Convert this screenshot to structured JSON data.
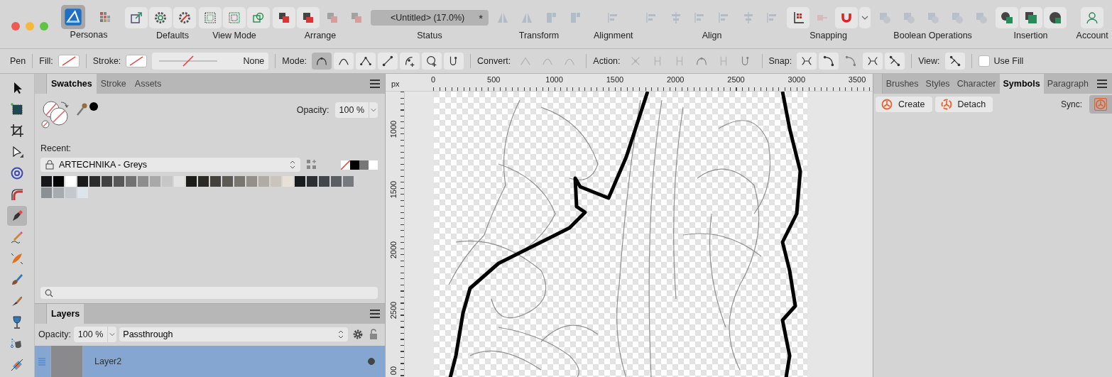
{
  "toolbar": {
    "groups": [
      {
        "kind": "buttons",
        "label": "Personas",
        "buttons": [
          {
            "selected": true,
            "disabled": false
          },
          {
            "selected": false,
            "disabled": false
          }
        ]
      },
      {
        "kind": "buttons",
        "buttons": [
          {
            "disabled": false
          }
        ]
      },
      {
        "kind": "buttons",
        "label": "Defaults",
        "buttons": [
          {
            "disabled": false
          },
          {
            "disabled": false
          }
        ]
      },
      {
        "kind": "buttons",
        "label": "View Mode",
        "buttons": [
          {
            "disabled": false
          },
          {
            "disabled": false
          },
          {
            "disabled": false
          }
        ]
      },
      {
        "kind": "buttons",
        "label": "Arrange",
        "buttons": [
          {
            "disabled": false
          },
          {
            "disabled": false
          },
          {
            "disabled": true
          },
          {
            "disabled": true
          }
        ]
      },
      {
        "kind": "status",
        "label": "Status",
        "title": "<Untitled> (17.0%)",
        "modified": "*"
      },
      {
        "kind": "buttons",
        "label": "Transform",
        "buttons": [
          {
            "disabled": true
          },
          {
            "disabled": true
          },
          {
            "disabled": true
          },
          {
            "disabled": true
          }
        ]
      },
      {
        "kind": "buttons",
        "label": "Alignment",
        "buttons": [
          {
            "disabled": true
          }
        ]
      },
      {
        "kind": "buttons",
        "label": "Align",
        "buttons": [
          {
            "disabled": true
          },
          {
            "disabled": true
          },
          {
            "disabled": true
          },
          {
            "disabled": true
          },
          {
            "disabled": true
          },
          {
            "disabled": true
          }
        ]
      },
      {
        "kind": "buttons",
        "label": "Snapping",
        "buttons": [
          {
            "disabled": false
          },
          {
            "disabled": true
          },
          {
            "disabled": false
          },
          {
            "disabled": false
          }
        ]
      },
      {
        "kind": "buttons",
        "label": "Boolean Operations",
        "buttons": [
          {
            "disabled": true
          },
          {
            "disabled": true
          },
          {
            "disabled": true
          },
          {
            "disabled": true
          },
          {
            "disabled": true
          }
        ]
      },
      {
        "kind": "buttons",
        "label": "Insertion",
        "buttons": [
          {
            "disabled": false
          },
          {
            "disabled": false
          },
          {
            "disabled": false
          }
        ]
      },
      {
        "kind": "buttons",
        "label": "Account",
        "buttons": [
          {
            "disabled": false
          }
        ]
      }
    ]
  },
  "context_toolbar": {
    "tool": "Pen",
    "fill_label": "Fill:",
    "stroke_label": "Stroke:",
    "stroke_width": "None",
    "sections": [
      {
        "label": "Mode:",
        "buttons": [
          {
            "selected": true,
            "disabled": false
          },
          {
            "selected": false,
            "disabled": false
          },
          {
            "selected": false,
            "disabled": false
          },
          {
            "selected": false,
            "disabled": false
          },
          {
            "selected": false,
            "disabled": false
          },
          {
            "selected": false,
            "disabled": false
          },
          {
            "selected": false,
            "disabled": false
          }
        ]
      },
      {
        "label": "Convert:",
        "buttons": [
          {
            "disabled": true
          },
          {
            "disabled": true
          },
          {
            "disabled": true
          }
        ]
      },
      {
        "label": "Action:",
        "buttons": [
          {
            "disabled": true
          },
          {
            "disabled": true
          },
          {
            "disabled": true
          },
          {
            "disabled": true
          },
          {
            "disabled": true
          },
          {
            "disabled": true
          }
        ]
      },
      {
        "label": "Snap:",
        "buttons": [
          {
            "disabled": false
          },
          {
            "disabled": false
          },
          {
            "disabled": true
          },
          {
            "disabled": false
          },
          {
            "disabled": false
          }
        ]
      },
      {
        "label": "View:",
        "buttons": [
          {
            "disabled": false
          }
        ]
      }
    ],
    "use_fill": {
      "label": "Use Fill",
      "checked": false
    }
  },
  "tools": [
    {
      "selected": false
    },
    {
      "selected": false
    },
    {
      "selected": false
    },
    {
      "selected": false
    },
    {
      "selected": false
    },
    {
      "selected": false
    },
    {
      "selected": true
    },
    {
      "selected": false
    },
    {
      "selected": false
    },
    {
      "selected": false
    },
    {
      "selected": false
    },
    {
      "selected": false
    },
    {
      "selected": false
    },
    {
      "selected": false
    }
  ],
  "swatches_panel": {
    "tabs": [
      {
        "label": "Swatches",
        "selected": true
      },
      {
        "label": "Stroke",
        "selected": false
      },
      {
        "label": "Assets",
        "selected": false
      }
    ],
    "opacity_label": "Opacity:",
    "opacity": "100 %",
    "recent_label": "Recent:",
    "palette": "ARTECHNIKA - Greys",
    "recent_colors": [
      {
        "kind": "none"
      },
      {
        "kind": "color",
        "color": "#000000"
      },
      {
        "kind": "color",
        "color": "#777777"
      },
      {
        "kind": "color",
        "color": "#ffffff"
      }
    ],
    "swatches": [
      {
        "color": "#15151a"
      },
      {
        "color": "#050505"
      },
      {
        "color": "#ffffff"
      },
      {
        "color": "#1a1a1a"
      },
      {
        "color": "#2c2c2c"
      },
      {
        "color": "#414141"
      },
      {
        "color": "#575757"
      },
      {
        "color": "#727272"
      },
      {
        "color": "#8d8d8d"
      },
      {
        "color": "#a9a9a9"
      },
      {
        "color": "#c6c6c6"
      },
      {
        "color": "#e3e3e3"
      },
      {
        "color": "#1c1c19"
      },
      {
        "color": "#2b2a27"
      },
      {
        "color": "#43413c"
      },
      {
        "color": "#5b5a55"
      },
      {
        "color": "#787670"
      },
      {
        "color": "#948f88"
      },
      {
        "color": "#b0aba3"
      },
      {
        "color": "#cbc4bb"
      },
      {
        "color": "#e7e0d6"
      },
      {
        "color": "#1a1b1d"
      },
      {
        "color": "#2d2f32"
      },
      {
        "color": "#43464b"
      },
      {
        "color": "#5b5e63"
      },
      {
        "color": "#76797e"
      },
      {
        "color": "#8b9095"
      },
      {
        "color": "#a6abb0"
      },
      {
        "color": "#c2c8ce"
      },
      {
        "color": "#dde4ec"
      }
    ]
  },
  "layers_panel": {
    "tabs": [
      {
        "label": "Layers",
        "selected": true
      }
    ],
    "opacity_label": "Opacity:",
    "opacity": "100 %",
    "blend_mode": "Passthrough",
    "layers": [
      {
        "name": "Layer2",
        "selected": true,
        "visible": true
      }
    ]
  },
  "canvas": {
    "ruler_unit": "px",
    "x_labels": [
      "0",
      "500",
      "1000",
      "1500",
      "2000",
      "2500",
      "3000",
      "3500"
    ],
    "y_labels": [
      "1000",
      "1500",
      "2000",
      "2500",
      "00"
    ]
  },
  "right_panel": {
    "tabs": [
      {
        "label": "Brushes",
        "selected": false
      },
      {
        "label": "Styles",
        "selected": false
      },
      {
        "label": "Character",
        "selected": false
      },
      {
        "label": "Symbols",
        "selected": true
      },
      {
        "label": "Paragraph",
        "selected": false
      }
    ],
    "buttons": [
      "Create",
      "Detach"
    ],
    "sync_label": "Sync:",
    "sync_on": true
  }
}
